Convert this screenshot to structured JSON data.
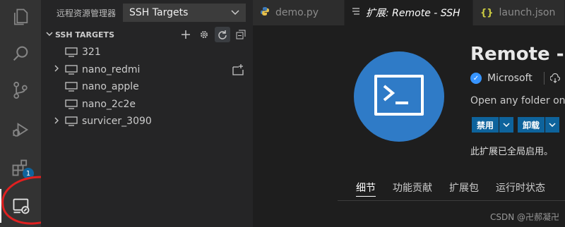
{
  "activitybar": {
    "items": [
      "explorer-icon",
      "search-icon",
      "source-control-icon",
      "run-debug-icon",
      "extensions-icon",
      "remote-explorer-icon"
    ],
    "extensions_badge": "1"
  },
  "sidebar": {
    "title": "远程资源管理器",
    "selector_value": "SSH Targets",
    "section_title": "SSH TARGETS",
    "targets": [
      {
        "label": "321",
        "expandable": false
      },
      {
        "label": "nano_redmi",
        "expandable": true
      },
      {
        "label": "nano_apple",
        "expandable": false
      },
      {
        "label": "nano_2c2e",
        "expandable": false
      },
      {
        "label": "survicer_3090",
        "expandable": true
      }
    ]
  },
  "tabs": [
    {
      "label": "demo.py",
      "icon": "python-icon"
    },
    {
      "label": "扩展: Remote - SSH",
      "icon": "extension-icon"
    },
    {
      "label": "launch.json",
      "icon": "json-icon"
    }
  ],
  "extension": {
    "name": "Remote - S",
    "publisher": "Microsoft",
    "description": "Open any folder on",
    "disable_label": "禁用",
    "uninstall_label": "卸载",
    "global_status": "此扩展已全局启用。",
    "detail_tabs": [
      "细节",
      "功能贡献",
      "扩展包",
      "运行时状态"
    ]
  },
  "watermark": "CSDN @卍郝凝卍",
  "colors": {
    "accent": "#0e639c",
    "logo_blue": "#2f7bc7",
    "annotation_red": "#e02020"
  }
}
